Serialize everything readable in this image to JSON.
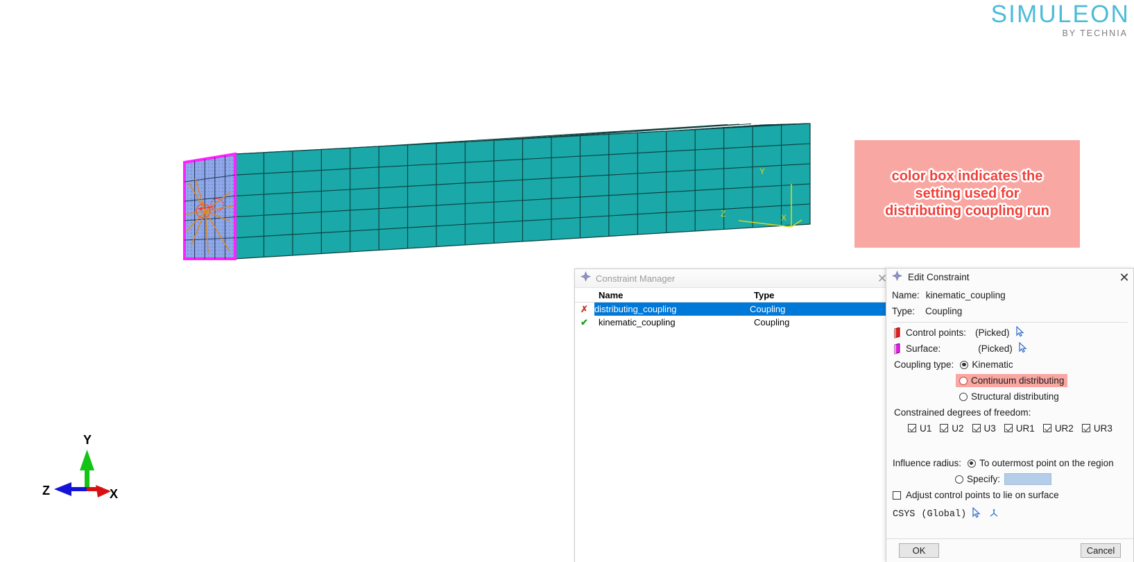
{
  "logo": {
    "brand": "SIMULEON",
    "tagline": "BY TECHNIA",
    "brand_color": "#4cbcd8",
    "tagline_color": "#7d7d7d"
  },
  "viewport": {
    "triad": {
      "y_label": "Y",
      "x_label": "X",
      "z_label": "Z",
      "y_color": "#14c414",
      "x_color": "#d81010",
      "z_color": "#1414d8"
    },
    "model_csys": {
      "y_label": "Y",
      "z_label": "Z",
      "x_label": "X",
      "color": "#d8d820"
    },
    "mesh_color": "#1aa8a8",
    "mesh_edge_color": "#0c3c3c",
    "picked_surface_color": "#8fa8e8",
    "picked_surface_outline": "#ff20ff",
    "coupling_line_color": "#e08820"
  },
  "annotation": {
    "text": "color box indicates the setting used for distributing coupling run",
    "lines": [
      "color box indicates the",
      "setting used for",
      "distributing coupling run"
    ],
    "background": "#f9a7a2",
    "text_color": "#f0403a"
  },
  "constraint_manager": {
    "title": "Constraint Manager",
    "title_icon": "abaqus-diamond-icon",
    "close_label": "✕",
    "columns": [
      "Name",
      "Type"
    ],
    "rows": [
      {
        "status": "✗",
        "status_kind": "x",
        "name": "distributing_coupling",
        "type": "Coupling",
        "selected": true
      },
      {
        "status": "✔",
        "status_kind": "check",
        "name": "kinematic_coupling",
        "type": "Coupling",
        "selected": false
      }
    ],
    "selection_color": "#0078d7"
  },
  "edit_constraint": {
    "title": "Edit Constraint",
    "title_icon": "abaqus-diamond-icon",
    "close_label": "✕",
    "name_label": "Name:",
    "name_value": "kinematic_coupling",
    "type_label": "Type:",
    "type_value": "Coupling",
    "control_points_label": "Control points:",
    "control_points_value": "(Picked)",
    "surface_label": "Surface:",
    "surface_value": "(Picked)",
    "coupling_type_label": "Coupling type:",
    "coupling_options": [
      {
        "label": "Kinematic",
        "selected": true,
        "highlighted": false
      },
      {
        "label": "Continuum distributing",
        "selected": false,
        "highlighted": true
      },
      {
        "label": "Structural distributing",
        "selected": false,
        "highlighted": false
      }
    ],
    "dof_label": "Constrained degrees of freedom:",
    "dof": [
      {
        "label": "U1",
        "checked": true
      },
      {
        "label": "U2",
        "checked": true
      },
      {
        "label": "U3",
        "checked": true
      },
      {
        "label": "UR1",
        "checked": true
      },
      {
        "label": "UR2",
        "checked": true
      },
      {
        "label": "UR3",
        "checked": true
      }
    ],
    "influence_label": "Influence radius:",
    "influence_options": [
      {
        "label": "To outermost point on the region",
        "selected": true
      },
      {
        "label": "Specify:",
        "selected": false
      }
    ],
    "specify_value": "",
    "adjust_label": "Adjust control points to lie on surface",
    "adjust_checked": false,
    "csys_label": "CSYS",
    "csys_value": "(Global)",
    "ok_label": "OK",
    "cancel_label": "Cancel",
    "highlight_color": "#f9a7a2"
  }
}
